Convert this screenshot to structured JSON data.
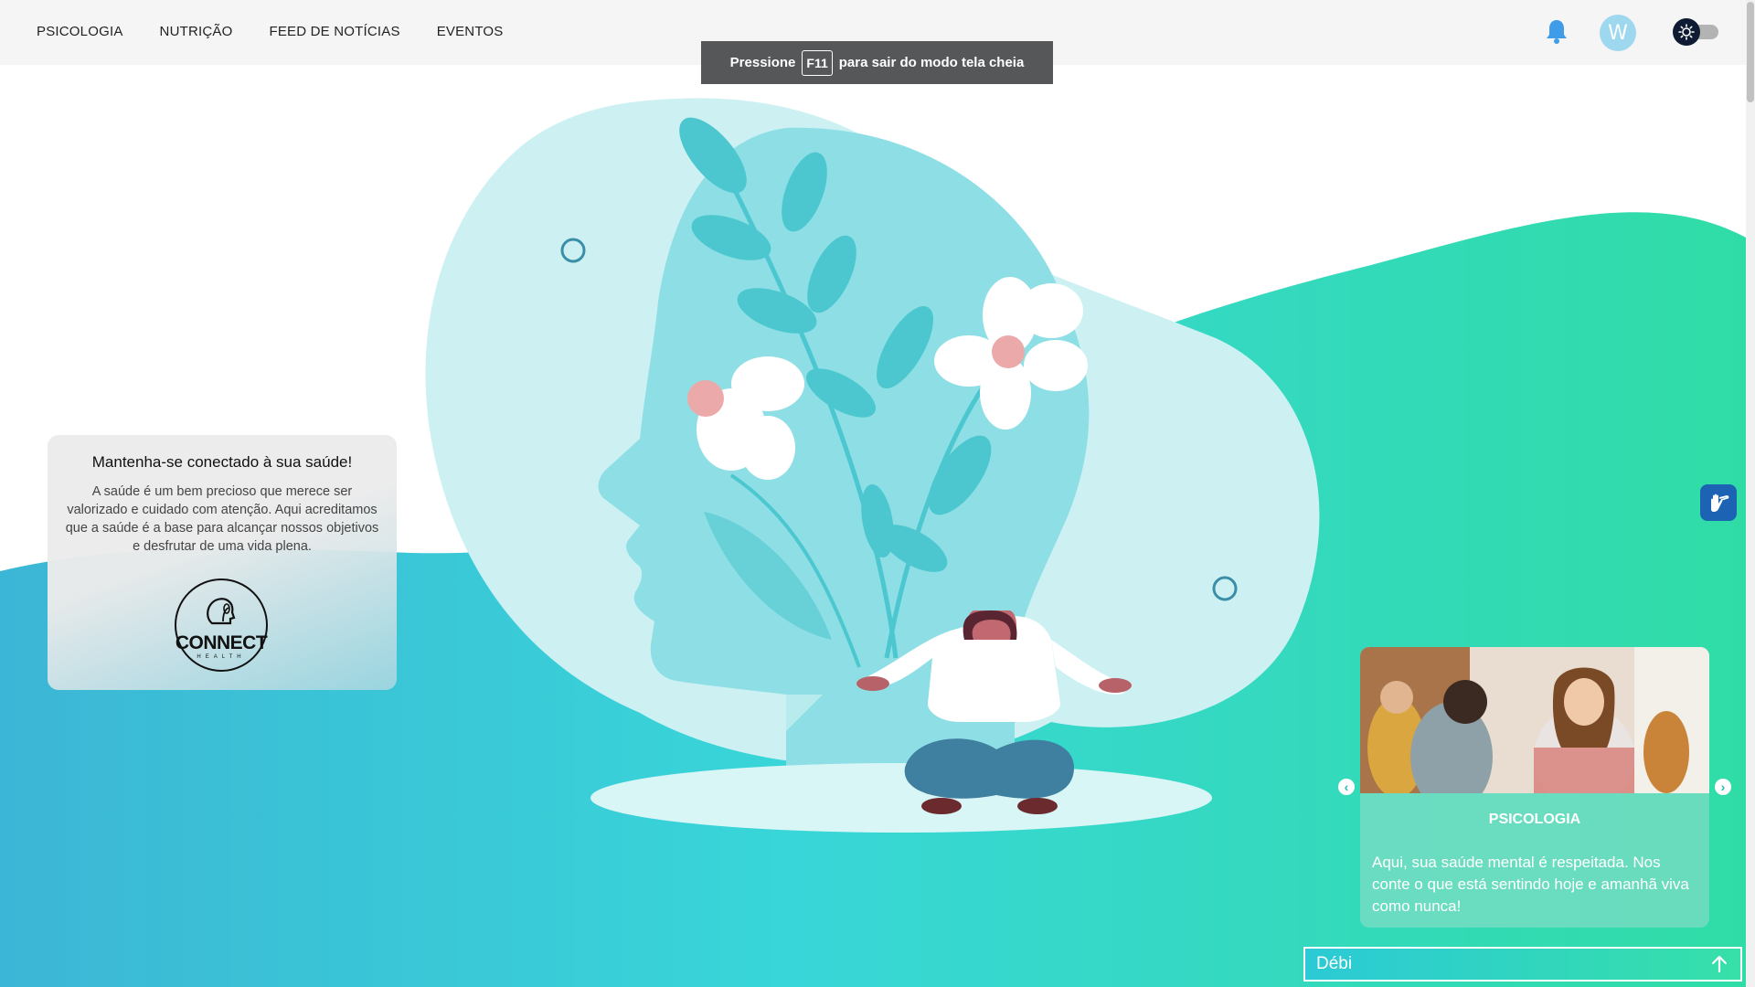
{
  "nav": {
    "items": [
      {
        "label": "PSICOLOGIA"
      },
      {
        "label": "NUTRIÇÃO"
      },
      {
        "label": "FEED DE NOTÍCIAS"
      },
      {
        "label": "EVENTOS"
      }
    ]
  },
  "header": {
    "avatar_initial": "W",
    "bell_icon": "bell-icon",
    "theme_icon": "sun-icon"
  },
  "toast": {
    "prefix": "Pressione",
    "key": "F11",
    "suffix": "para sair do modo tela cheia"
  },
  "info_card": {
    "title": "Mantenha-se conectado à sua saúde!",
    "text": "A saúde é um bem precioso que merece ser valorizado e cuidado com atenção. Aqui acreditamos que a saúde é a base para alcançar nossos objetivos e desfrutar de uma vida plena.",
    "logo_text": "CONNECT",
    "logo_sub": "HEALTH"
  },
  "carousel": {
    "title": "PSICOLOGIA",
    "text": "Aqui, sua saúde mental é respeitada. Nos conte o que está sentindo hoje e amanhã viva como nunca!",
    "prev_icon": "chevron-left-icon",
    "next_icon": "chevron-right-icon"
  },
  "chat": {
    "name": "Débi",
    "icon": "arrow-up-icon"
  },
  "colors": {
    "teal": "#2cc6d3",
    "green": "#33dba6",
    "navy": "#0e1b33",
    "bell": "#3f9ce8"
  }
}
